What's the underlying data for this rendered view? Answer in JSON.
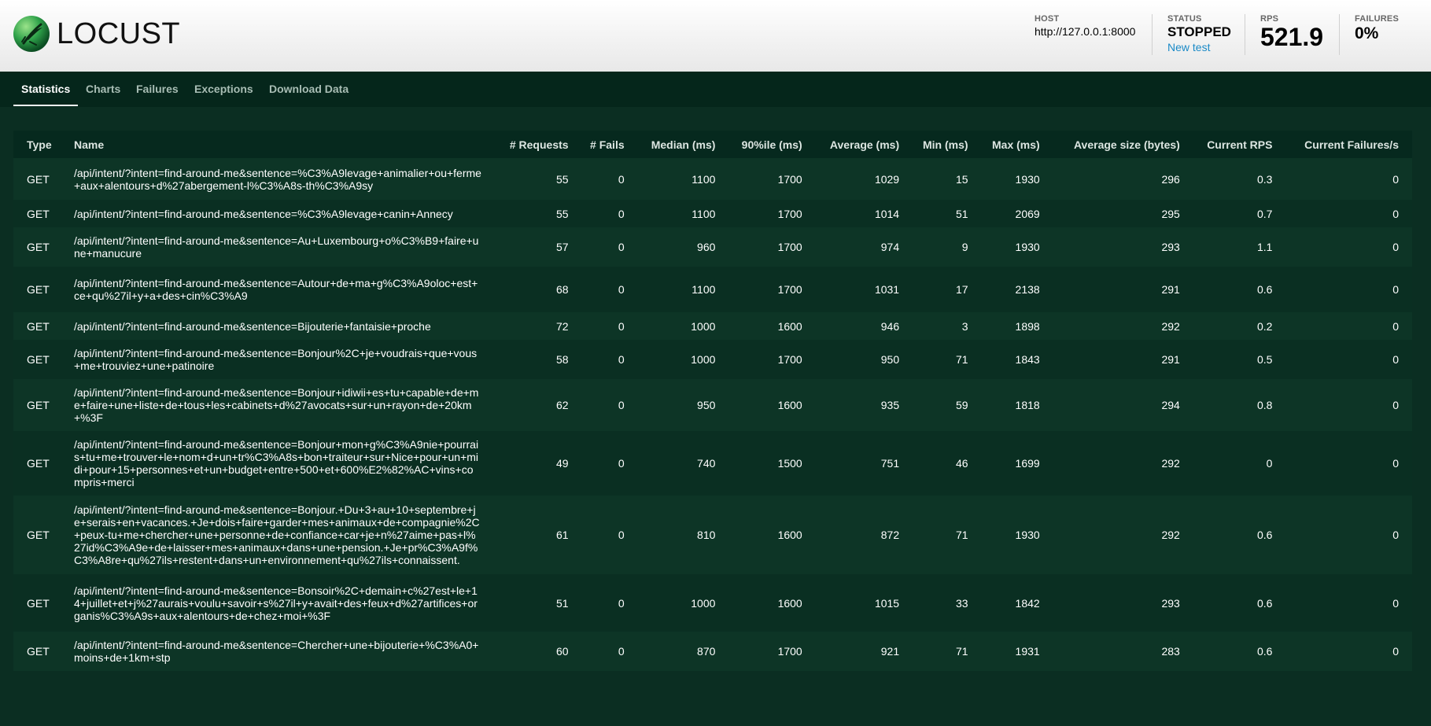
{
  "header": {
    "logo_text": "LOCUST",
    "host_label": "HOST",
    "host_value": "http://127.0.0.1:8000",
    "status_label": "STATUS",
    "status_value": "STOPPED",
    "new_test_label": "New test",
    "rps_label": "RPS",
    "rps_value": "521.9",
    "failures_label": "FAILURES",
    "failures_value": "0%"
  },
  "tabs": [
    {
      "label": "Statistics",
      "active": true
    },
    {
      "label": "Charts",
      "active": false
    },
    {
      "label": "Failures",
      "active": false
    },
    {
      "label": "Exceptions",
      "active": false
    },
    {
      "label": "Download Data",
      "active": false
    }
  ],
  "table": {
    "columns": [
      "Type",
      "Name",
      "# Requests",
      "# Fails",
      "Median (ms)",
      "90%ile (ms)",
      "Average (ms)",
      "Min (ms)",
      "Max (ms)",
      "Average size (bytes)",
      "Current RPS",
      "Current Failures/s"
    ],
    "rows": [
      [
        "GET",
        "/api/intent/?intent=find-around-me&sentence=%C3%A9levage+animalier+ou+ferme+aux+alentours+d%27abergement-l%C3%A8s-th%C3%A9sy",
        "55",
        "0",
        "1100",
        "1700",
        "1029",
        "15",
        "1930",
        "296",
        "0.3",
        "0"
      ],
      [
        "GET",
        "/api/intent/?intent=find-around-me&sentence=%C3%A9levage+canin+Annecy",
        "55",
        "0",
        "1100",
        "1700",
        "1014",
        "51",
        "2069",
        "295",
        "0.7",
        "0"
      ],
      [
        "GET",
        "/api/intent/?intent=find-around-me&sentence=Au+Luxembourg+o%C3%B9+faire+une+manucure",
        "57",
        "0",
        "960",
        "1700",
        "974",
        "9",
        "1930",
        "293",
        "1.1",
        "0"
      ],
      [
        "GET",
        "/api/intent/?intent=find-around-me&sentence=Autour+de+ma+g%C3%A9oloc+est+ce+qu%27il+y+a+des+cin%C3%A9",
        "68",
        "0",
        "1100",
        "1700",
        "1031",
        "17",
        "2138",
        "291",
        "0.6",
        "0"
      ],
      [
        "GET",
        "/api/intent/?intent=find-around-me&sentence=Bijouterie+fantaisie+proche",
        "72",
        "0",
        "1000",
        "1600",
        "946",
        "3",
        "1898",
        "292",
        "0.2",
        "0"
      ],
      [
        "GET",
        "/api/intent/?intent=find-around-me&sentence=Bonjour%2C+je+voudrais+que+vous+me+trouviez+une+patinoire",
        "58",
        "0",
        "1000",
        "1700",
        "950",
        "71",
        "1843",
        "291",
        "0.5",
        "0"
      ],
      [
        "GET",
        "/api/intent/?intent=find-around-me&sentence=Bonjour+idiwii+es+tu+capable+de+me+faire+une+liste+de+tous+les+cabinets+d%27avocats+sur+un+rayon+de+20km+%3F",
        "62",
        "0",
        "950",
        "1600",
        "935",
        "59",
        "1818",
        "294",
        "0.8",
        "0"
      ],
      [
        "GET",
        "/api/intent/?intent=find-around-me&sentence=Bonjour+mon+g%C3%A9nie+pourrais+tu+me+trouver+le+nom+d+un+tr%C3%A8s+bon+traiteur+sur+Nice+pour+un+midi+pour+15+personnes+et+un+budget+entre+500+et+600%E2%82%AC+vins+compris+merci",
        "49",
        "0",
        "740",
        "1500",
        "751",
        "46",
        "1699",
        "292",
        "0",
        "0"
      ],
      [
        "GET",
        "/api/intent/?intent=find-around-me&sentence=Bonjour.+Du+3+au+10+septembre+je+serais+en+vacances.+Je+dois+faire+garder+mes+animaux+de+compagnie%2C+peux-tu+me+chercher+une+personne+de+confiance+car+je+n%27aime+pas+l%27id%C3%A9e+de+laisser+mes+animaux+dans+une+pension.+Je+pr%C3%A9f%C3%A8re+qu%27ils+restent+dans+un+environnement+qu%27ils+connaissent.",
        "61",
        "0",
        "810",
        "1600",
        "872",
        "71",
        "1930",
        "292",
        "0.6",
        "0"
      ],
      [
        "GET",
        "/api/intent/?intent=find-around-me&sentence=Bonsoir%2C+demain+c%27est+le+14+juillet+et+j%27aurais+voulu+savoir+s%27il+y+avait+des+feux+d%27artifices+organis%C3%A9s+aux+alentours+de+chez+moi+%3F",
        "51",
        "0",
        "1000",
        "1600",
        "1015",
        "33",
        "1842",
        "293",
        "0.6",
        "0"
      ],
      [
        "GET",
        "/api/intent/?intent=find-around-me&sentence=Chercher+une+bijouterie+%C3%A0+moins+de+1km+stp",
        "60",
        "0",
        "870",
        "1700",
        "921",
        "71",
        "1931",
        "283",
        "0.6",
        "0"
      ]
    ]
  }
}
